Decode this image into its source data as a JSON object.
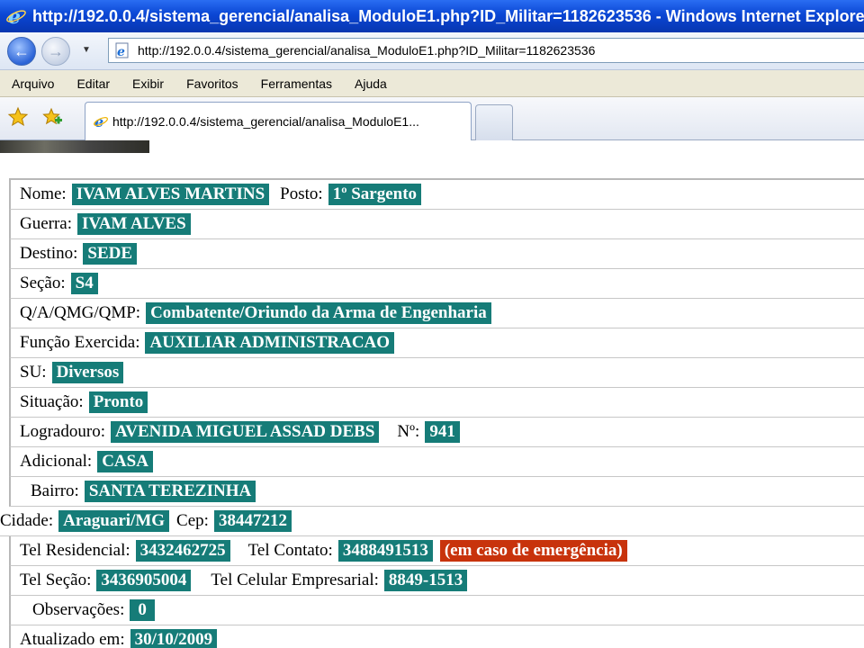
{
  "window": {
    "title": "http://192.0.0.4/sistema_gerencial/analisa_ModuloE1.php?ID_Militar=1182623536 - Windows Internet Explorer"
  },
  "address_bar": {
    "url": "http://192.0.0.4/sistema_gerencial/analisa_ModuloE1.php?ID_Militar=1182623536"
  },
  "menu": [
    "Arquivo",
    "Editar",
    "Exibir",
    "Favoritos",
    "Ferramentas",
    "Ajuda"
  ],
  "tab": {
    "title": "http://192.0.0.4/sistema_gerencial/analisa_ModuloE1..."
  },
  "colors": {
    "value_bg": "#167c78",
    "emergency_bg": "#c8330c",
    "titlebar": "#0a46d4"
  },
  "form": {
    "nome": {
      "label": "Nome:",
      "value": "IVAM ALVES MARTINS"
    },
    "posto": {
      "label": "Posto:",
      "value": "1º Sargento"
    },
    "guerra": {
      "label": "Guerra:",
      "value": "IVAM ALVES"
    },
    "destino": {
      "label": "Destino:",
      "value": "SEDE"
    },
    "secao": {
      "label": "Seção:",
      "value": "S4"
    },
    "qa": {
      "label": "Q/A/QMG/QMP:",
      "value": "Combatente/Oriundo da Arma de Engenharia"
    },
    "funcao": {
      "label": "Função Exercida:",
      "value": "AUXILIAR ADMINISTRACAO"
    },
    "su": {
      "label": "SU:",
      "value": "Diversos"
    },
    "situacao": {
      "label": "Situação:",
      "value": "Pronto"
    },
    "logradouro": {
      "label": "Logradouro:",
      "value": "AVENIDA MIGUEL ASSAD DEBS"
    },
    "numero": {
      "label": "Nº:",
      "value": "941"
    },
    "adicional": {
      "label": "Adicional:",
      "value": "CASA"
    },
    "bairro": {
      "label": "Bairro:",
      "value": "SANTA TEREZINHA"
    },
    "cidade": {
      "label": "Cidade:",
      "value": "Araguari/MG"
    },
    "cep": {
      "label": "Cep:",
      "value": "38447212"
    },
    "tel_residencial": {
      "label": "Tel Residencial:",
      "value": "3432462725"
    },
    "tel_contato": {
      "label": "Tel Contato:",
      "value": "3488491513"
    },
    "emergencia": "(em caso de emergência)",
    "tel_secao": {
      "label": "Tel Seção:",
      "value": "3436905004"
    },
    "tel_celular": {
      "label": "Tel Celular Empresarial:",
      "value": "8849-1513"
    },
    "observacoes": {
      "label": "Observações:",
      "value": "0"
    },
    "atualizado": {
      "label": "Atualizado em:",
      "value": "30/10/2009"
    }
  }
}
